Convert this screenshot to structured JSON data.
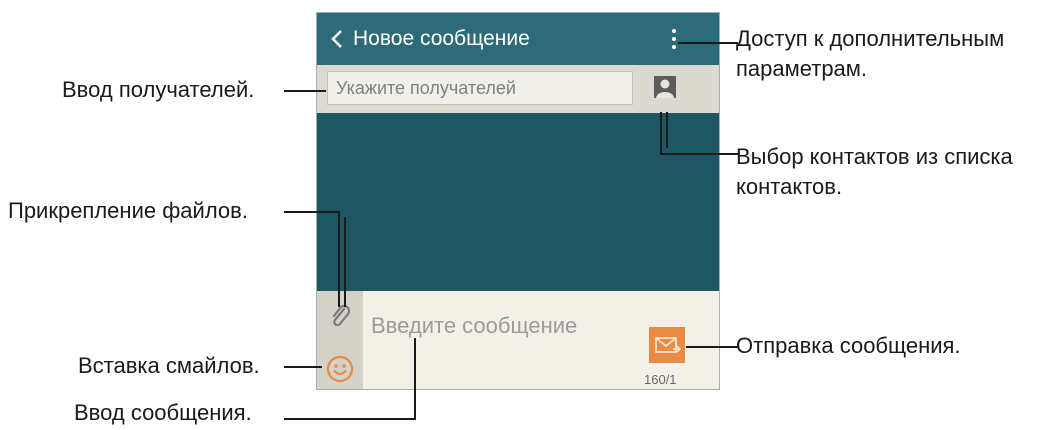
{
  "app": {
    "title": "Новое сообщение",
    "recipient_placeholder": "Укажите получателей",
    "message_placeholder": "Введите сообщение",
    "char_counter": "160/1"
  },
  "callouts": {
    "more_options": "Доступ к дополнительным параметрам.",
    "recipients_input": "Ввод получателей.",
    "select_contacts": "Выбор контактов из списка контактов.",
    "attach_files": "Прикрепление файлов.",
    "send_message": "Отправка сообщения.",
    "insert_emoticons": "Вставка смайлов.",
    "enter_message": "Ввод сообщения."
  },
  "colors": {
    "appbar": "#2c6b77",
    "body": "#1e5762",
    "send_accent": "#e78b45",
    "emoticon": "#e78b45"
  },
  "icons": [
    "back-icon",
    "more-options-icon",
    "contact-icon",
    "paperclip-icon",
    "smiley-icon",
    "send-envelope-icon"
  ]
}
